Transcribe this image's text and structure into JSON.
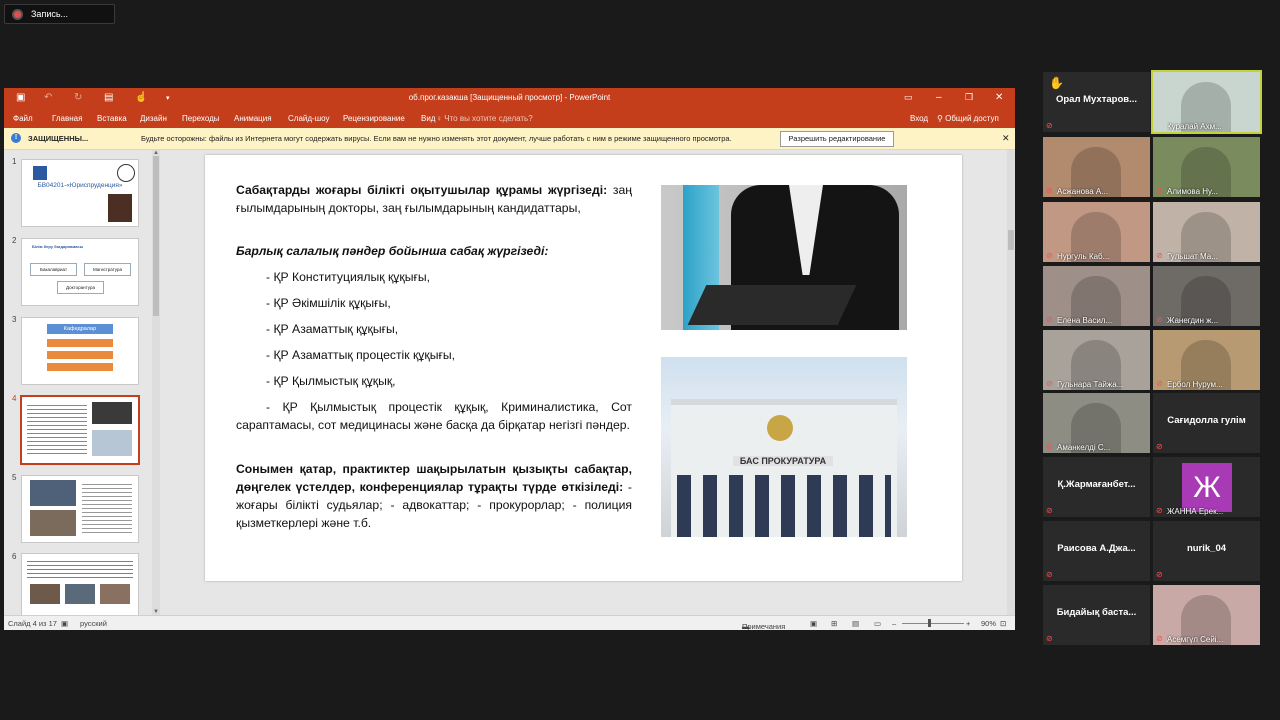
{
  "recording": {
    "label": "Запись..."
  },
  "ppt": {
    "window_title": "об.прог.казакша [Защищенный просмотр] - PowerPoint",
    "tabs": [
      "Файл",
      "Главная",
      "Вставка",
      "Дизайн",
      "Переходы",
      "Анимация",
      "Слайд-шоу",
      "Рецензирование",
      "Вид"
    ],
    "search_placeholder": "Что вы хотите сделать?",
    "signin": "Вход",
    "share": "Общий доступ",
    "warning": {
      "label": "ЗАЩИЩЕННЫ...",
      "message": "Будьте осторожны: файлы из Интернета могут содержать вирусы. Если вам не нужно изменять этот документ, лучше работать с ним в режиме защищенного просмотра.",
      "button": "Разрешить редактирование"
    },
    "thumbs": [
      {
        "num": "1",
        "text": "БВ04201-«Юриспруденция»"
      },
      {
        "num": "2",
        "text": "Білім беру бағдарламасы",
        "items": [
          "Бакалавриат",
          "Магистратура",
          "Докторантура"
        ]
      },
      {
        "num": "3",
        "text": "Кафедралар"
      },
      {
        "num": "4",
        "text": ""
      },
      {
        "num": "5",
        "text": ""
      },
      {
        "num": "6",
        "text": ""
      }
    ],
    "slide": {
      "heading1": "Сабақтарды жоғары білікті оқытушылар құрамы жүргізеді:",
      "heading1_rest": " заң ғылымдарының докторы, заң ғылымдарының кандидаттары,",
      "heading2": "Барлық салалық пәндер бойынша сабақ жүргізеді:",
      "items": [
        "- ҚР Конституциялық құқығы,",
        "- ҚР Әкімшілік құқығы,",
        "- ҚР Азаматтық құқығы,",
        "- ҚР Азаматтық процестік құқығы,",
        "- ҚР Қылмыстық құқық,"
      ],
      "last_item": "- ҚР Қылмыстық процестік құқық, Криминалистика, Сот сараптамасы, сот медицинасы және басқа да бірқатар негізгі пәндер.",
      "para_bold": "Сонымен қатар, практиктер шақырылатын қызықты сабақтар, дөңгелек үстелдер, конференциялар тұрақты түрде өткізіледі:",
      "para_rest": "   - жоғары білікті судьялар; - адвокаттар; - прокурорлар; - полиция қызметкерлері және т.б.",
      "building_sign": "БАС ПРОКУРАТУРА"
    },
    "status": {
      "slide": "Слайд 4 из 17",
      "lang": "русский",
      "notes": "Примечания",
      "zoom": "90%"
    }
  },
  "participants": [
    {
      "name": "Орал  Мухтаров...",
      "type": "name",
      "hand": true
    },
    {
      "name": "Куралай Ахм...",
      "type": "video",
      "color": "#c9d6d0",
      "active": true
    },
    {
      "name": "Асжанова А...",
      "type": "video",
      "color": "#b28a6e"
    },
    {
      "name": "Алимова Ну...",
      "type": "video",
      "color": "#7a8c5e"
    },
    {
      "name": "Нургуль Каб...",
      "type": "video",
      "color": "#c09884"
    },
    {
      "name": "Гульшат Ма...",
      "type": "video",
      "color": "#c0b2a6"
    },
    {
      "name": "Елена Васил...",
      "type": "video",
      "color": "#9e8f88"
    },
    {
      "name": "Жанегдин ж...",
      "type": "video",
      "color": "#6e6a66"
    },
    {
      "name": "Гульнара Тайжа...",
      "type": "video",
      "color": "#a8a29a"
    },
    {
      "name": "Ербол Нурум...",
      "type": "video",
      "color": "#b79a72"
    },
    {
      "name": "Аманкелді С...",
      "type": "video",
      "color": "#8d8d83"
    },
    {
      "name": "Сағидолла гулім",
      "type": "name"
    },
    {
      "name": "Қ.Жармағанбет...",
      "type": "name"
    },
    {
      "name": "ЖАННА Ерек...",
      "type": "avatar",
      "letter": "Ж"
    },
    {
      "name": "Раисова  А.Джа...",
      "type": "name"
    },
    {
      "name": "nurik_04",
      "type": "name"
    },
    {
      "name": "Бидайық баста...",
      "type": "name"
    },
    {
      "name": "Асемгүл Сейі...",
      "type": "video",
      "color": "#c8a9a5"
    }
  ]
}
